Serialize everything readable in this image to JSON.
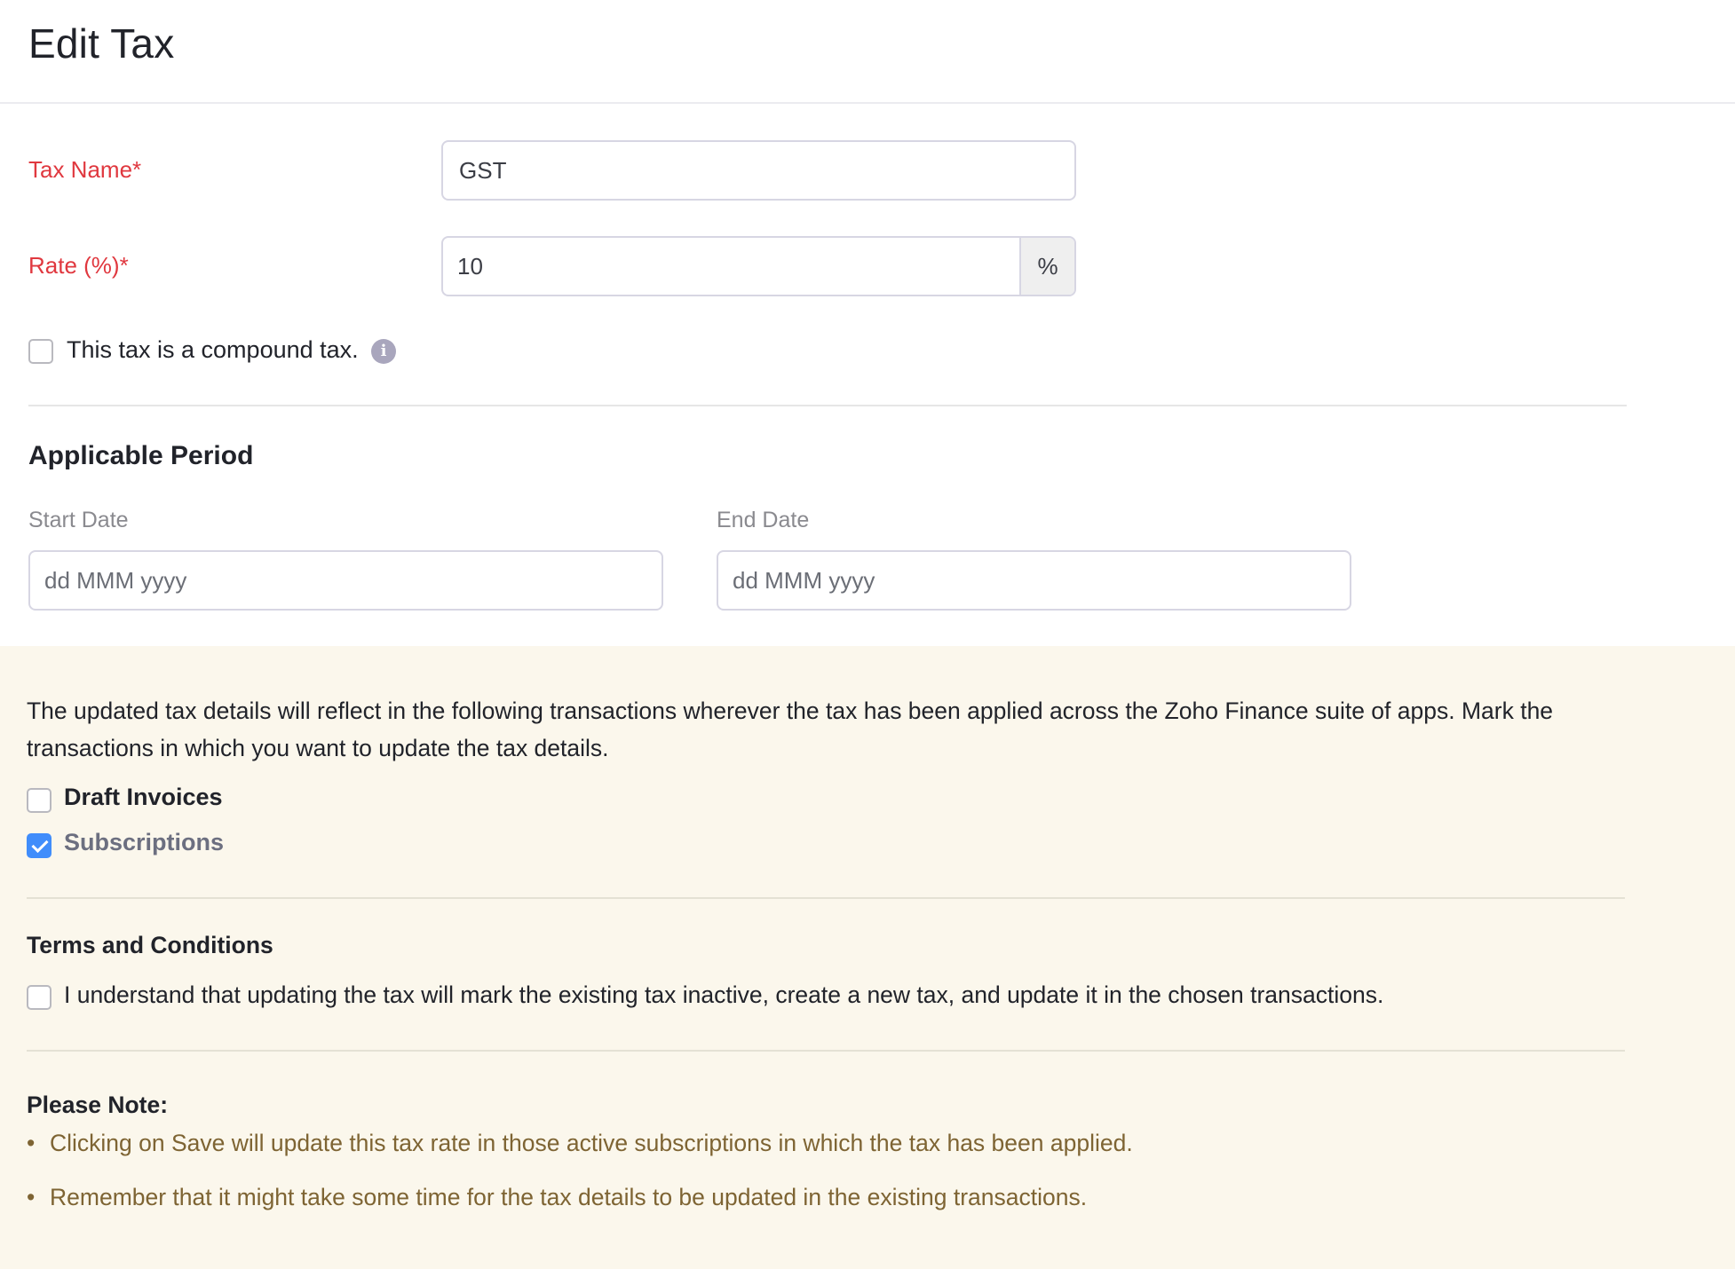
{
  "header": {
    "title": "Edit Tax"
  },
  "form": {
    "tax_name": {
      "label": "Tax Name*",
      "value": "GST"
    },
    "rate": {
      "label": "Rate (%)*",
      "value": "10",
      "suffix": "%"
    },
    "compound": {
      "label": "This tax is a compound tax.",
      "checked": false,
      "info_icon": "i"
    }
  },
  "applicable_period": {
    "title": "Applicable Period",
    "start_date": {
      "label": "Start Date",
      "placeholder": "dd MMM yyyy",
      "value": ""
    },
    "end_date": {
      "label": "End Date",
      "placeholder": "dd MMM yyyy",
      "value": ""
    }
  },
  "notice": {
    "description": "The updated tax details will reflect in the following transactions wherever the tax has been applied across the Zoho Finance suite of apps. Mark the transactions in which you want to update the tax details.",
    "options": [
      {
        "label": "Draft Invoices",
        "checked": false
      },
      {
        "label": "Subscriptions",
        "checked": true
      }
    ],
    "terms": {
      "title": "Terms and Conditions",
      "label": "I understand that updating the tax will mark the existing tax inactive, create a new tax, and update it in the chosen transactions.",
      "checked": false
    },
    "please_note": {
      "title": "Please Note:",
      "bullet": "•",
      "items": [
        "Clicking on Save will update this tax rate in those active subscriptions in which the tax has been applied.",
        "Remember that it might take some time for the tax details to be updated in the existing transactions."
      ]
    }
  },
  "colors": {
    "required_label": "#e0383f",
    "checkbox_checked": "#408dfb",
    "notice_background": "#fbf7ec",
    "note_text": "#7e6433"
  }
}
